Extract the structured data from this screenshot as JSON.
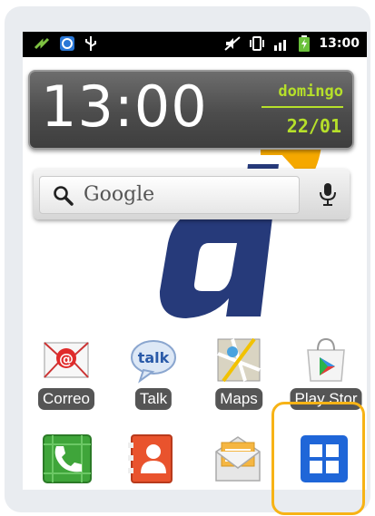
{
  "status_bar": {
    "time": "13:00",
    "icons_left": [
      "sync-icon",
      "browser-icon",
      "usb-icon"
    ],
    "icons_right": [
      "mute-icon",
      "vibrate-icon",
      "signal-icon",
      "battery-icon"
    ]
  },
  "clock_widget": {
    "time": "13:00",
    "day": "domingo",
    "date": "22/01"
  },
  "search_widget": {
    "label": "Google"
  },
  "apps": [
    {
      "label": "Correo",
      "icon": "email-icon"
    },
    {
      "label": "Talk",
      "icon": "talk-icon"
    },
    {
      "label": "Maps",
      "icon": "maps-icon"
    },
    {
      "label": "Play Stor",
      "icon": "play-store-icon"
    }
  ],
  "dock": [
    {
      "icon": "phone-icon"
    },
    {
      "icon": "contacts-icon"
    },
    {
      "icon": "messaging-icon"
    },
    {
      "icon": "app-drawer-icon"
    }
  ],
  "colors": {
    "clock_accent": "#b6e02a",
    "wallpaper_blue": "#263a7a",
    "wallpaper_orange": "#f5a800",
    "highlight": "#f7b316"
  }
}
